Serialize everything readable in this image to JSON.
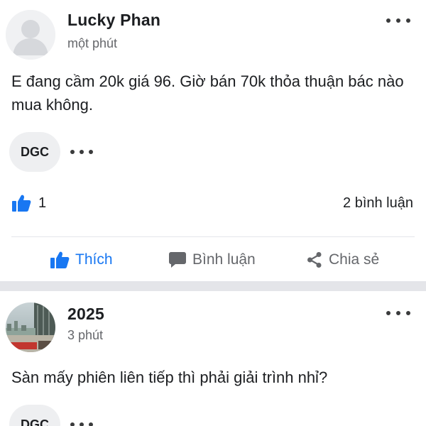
{
  "posts": [
    {
      "author": "Lucky Phan",
      "time": "một phút",
      "content": "E đang cầm 20k giá 96. Giờ bán 70k thỏa thuận bác nào mua không.",
      "tag": "DGC",
      "like_count": "1",
      "comment_count": "2 bình luận",
      "liked": true
    },
    {
      "author": "2025",
      "time": "3 phút",
      "content": "Sàn mấy phiên liên tiếp thì phải giải trình nhỉ?",
      "tag": "DGC"
    }
  ],
  "actions": {
    "like_label": "Thích",
    "comment_label": "Bình luận",
    "share_label": "Chia sẻ"
  },
  "icons": {
    "thumbs_up": "thumbs-up-icon",
    "comment": "comment-icon",
    "share": "share-icon",
    "more": "more-options-icon",
    "avatar": "avatar"
  },
  "colors": {
    "accent": "#1877f2",
    "muted_text": "#65676b",
    "tag_bg": "#eeeff1",
    "separator": "#e4e5e9"
  }
}
